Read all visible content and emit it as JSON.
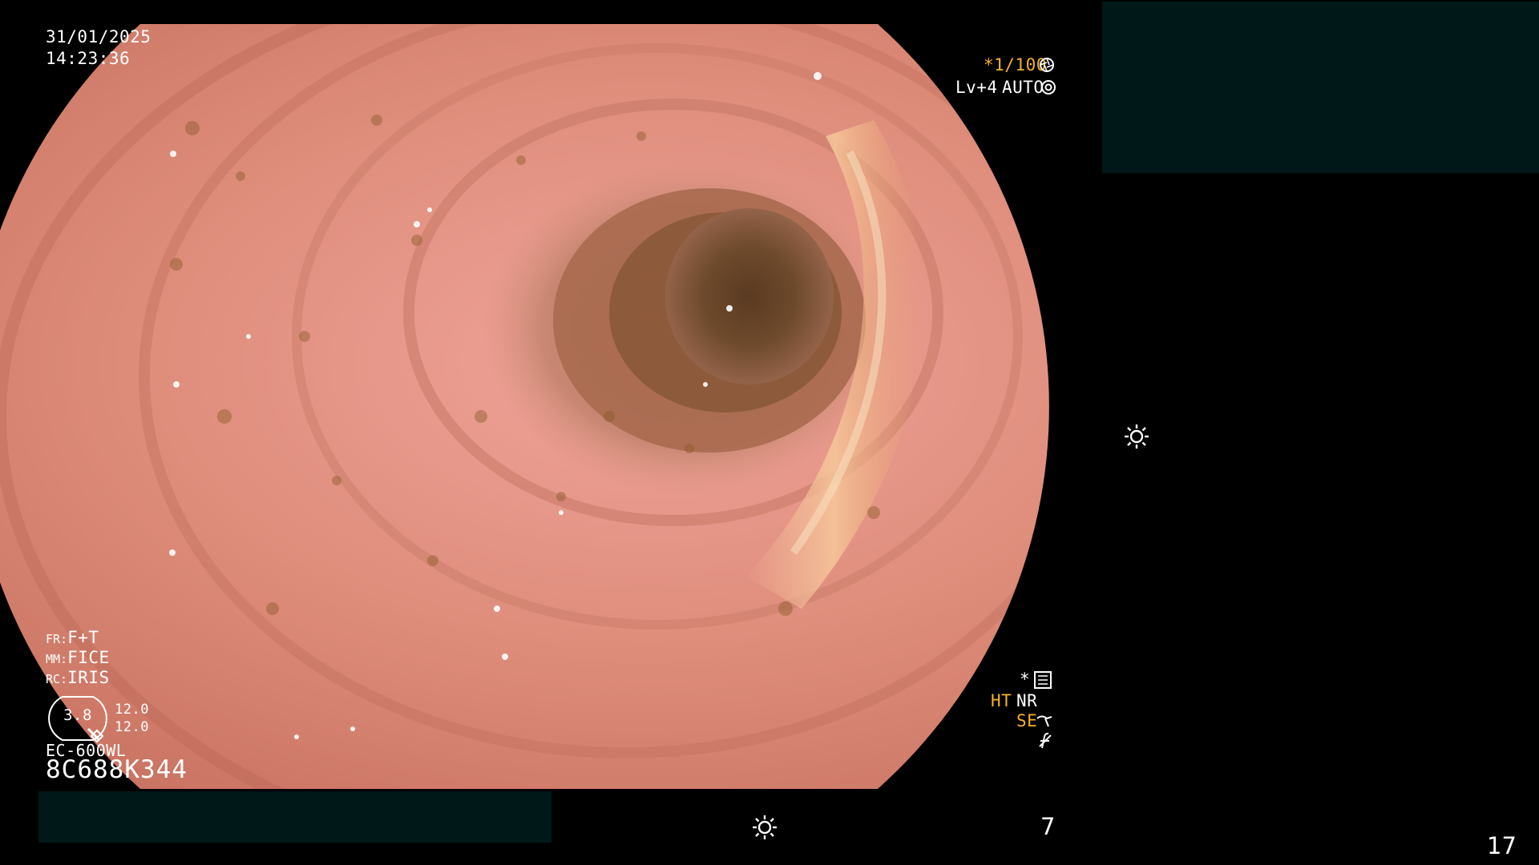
{
  "overlay": {
    "date": "31/01/2025",
    "time": "14:23:36",
    "shutter": "*1/100",
    "level": "Lv+4",
    "exposure_mode": "AUTO",
    "fr_label": "FR:",
    "fr_value": "F+T",
    "mm_label": "MM:",
    "mm_value": "FICE",
    "rc_label": "RC:",
    "rc_value": "IRIS",
    "gauge_value": "3.8",
    "gauge_top": "12.0",
    "gauge_bottom": "12.0",
    "scope_model": "EC-600WL",
    "serial": "8C688K344",
    "ht": "HT",
    "nr": "NR",
    "se": "SE",
    "asterisk": "*",
    "bottom_number": "7",
    "corner_number": "17"
  },
  "icons": {
    "shutter": "aperture-icon",
    "auto": "auto-exposure-icon",
    "brightness": "sun-icon",
    "settings": "settings-box-icon",
    "se": "enhancement-icon",
    "slash": "slash-f-icon"
  },
  "colors": {
    "background": "#000000",
    "text": "#ffffff",
    "highlight": "#f7b02a",
    "panel": "#011818"
  }
}
